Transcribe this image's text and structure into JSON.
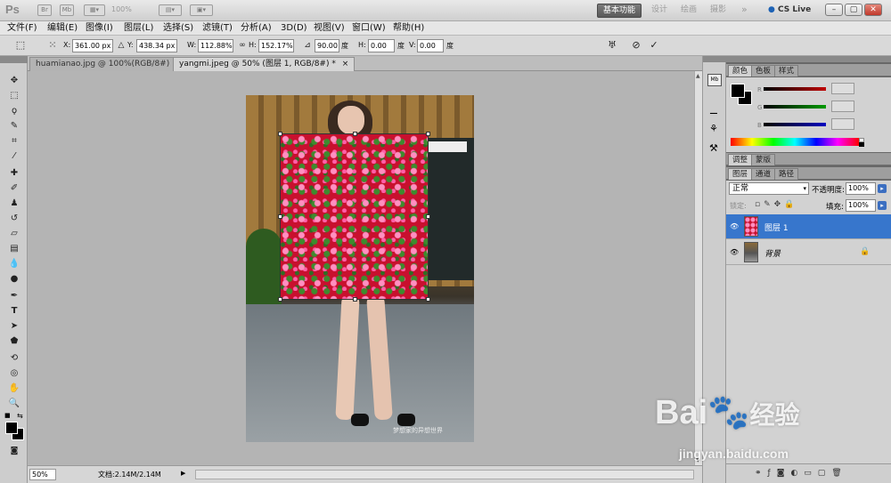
{
  "app": {
    "logo": "Ps"
  },
  "titlebar": {
    "icons": [
      "Br",
      "Mb"
    ],
    "zoom": "100%",
    "workspaces": [
      "基本功能",
      "设计",
      "绘画",
      "摄影"
    ],
    "more": "»",
    "cslive": "CS Live",
    "window_buttons": [
      "–",
      "▢",
      "✕"
    ]
  },
  "menu": [
    "文件(F)",
    "编辑(E)",
    "图像(I)",
    "图层(L)",
    "选择(S)",
    "滤镜(T)",
    "分析(A)",
    "3D(D)",
    "视图(V)",
    "窗口(W)",
    "帮助(H)"
  ],
  "options": {
    "x_label": "X:",
    "x": "361.00 px",
    "y_label": "Y:",
    "y": "438.34 px",
    "w_label": "W:",
    "w": "112.88%",
    "h_label": "H:",
    "h": "152.17%",
    "angle": "90.00",
    "deg1": "度",
    "hskew_label": "H:",
    "hskew": "0.00",
    "deg2": "度",
    "vskew_label": "V:",
    "vskew": "0.00",
    "deg3": "度"
  },
  "tabs": [
    {
      "label": "huamianao.jpg @ 100%(RGB/8#)",
      "close": "×"
    },
    {
      "label": "yangmi.jpeg @ 50% (图层 1, RGB/8#) *",
      "close": "×"
    }
  ],
  "status": {
    "zoom": "50%",
    "doc": "文档:2.14M/2.14M"
  },
  "color_panel": {
    "tabs": [
      "颜色",
      "色板",
      "样式"
    ],
    "channels": [
      {
        "label": "R",
        "value": ""
      },
      {
        "label": "G",
        "value": ""
      },
      {
        "label": "B",
        "value": ""
      }
    ],
    "colors": {
      "r": "#c00000",
      "g": "#009a00",
      "b": "#0000c0"
    }
  },
  "adjust_panel": {
    "tabs": [
      "调整",
      "蒙版"
    ]
  },
  "layers_panel": {
    "tabs": [
      "图层",
      "通道",
      "路径"
    ],
    "blend_mode": "正常",
    "opacity_label": "不透明度:",
    "opacity": "100%",
    "lock_label": "锁定:",
    "fill_label": "填充:",
    "fill": "100%",
    "layers": [
      {
        "name": "图层 1",
        "selected": true
      },
      {
        "name": "背景",
        "selected": false
      }
    ]
  },
  "canvas_caption": "梦想家的异想世界",
  "watermark": {
    "brand": "Bai",
    "brand_cn": "经验",
    "url": "jingyan.baidu.com"
  }
}
